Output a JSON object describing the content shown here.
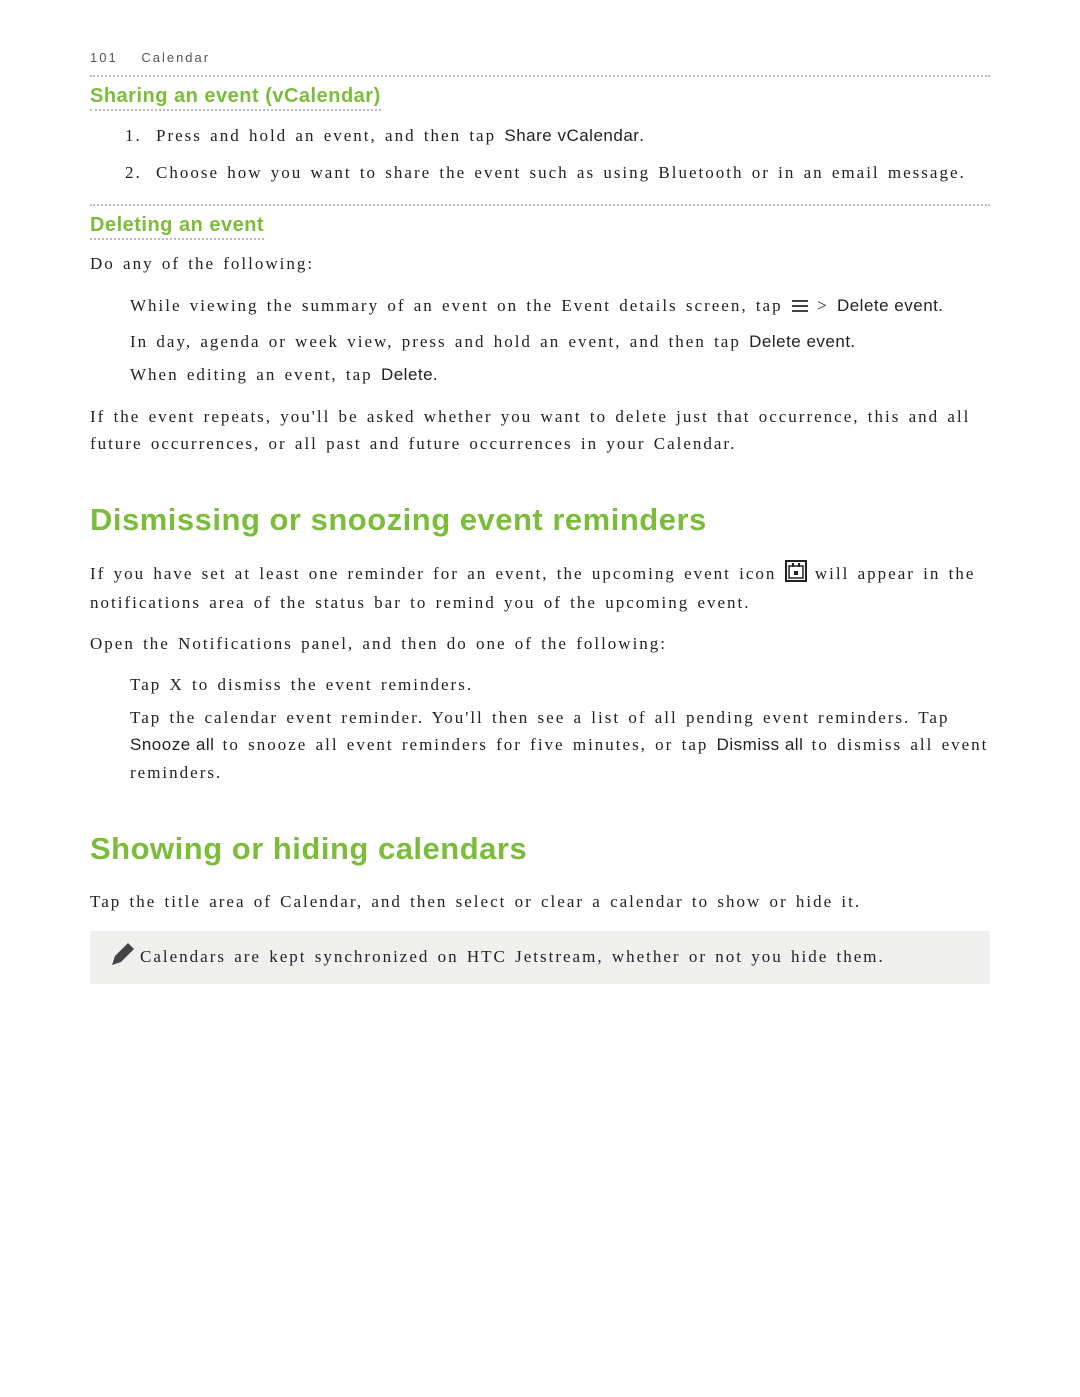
{
  "header": {
    "page_number": "101",
    "section": "Calendar"
  },
  "sharing": {
    "heading": "Sharing an event (vCalendar)",
    "steps": [
      {
        "pre": "Press and hold an event, and then tap ",
        "bold": "Share vCalendar",
        "post": "."
      },
      {
        "pre": "Choose how you want to share the event such as using Bluetooth or in an email message.",
        "bold": "",
        "post": ""
      }
    ]
  },
  "deleting": {
    "heading": "Deleting an event",
    "intro": "Do any of the following:",
    "items": [
      {
        "pre": "While viewing the summary of an event on the Event details screen, tap ",
        "icon": "menu",
        "mid": " > ",
        "bold": "Delete event",
        "post": "."
      },
      {
        "pre": "In day, agenda or week view, press and hold an event, and then tap ",
        "icon": "",
        "mid": "",
        "bold": "Delete event",
        "post": "."
      },
      {
        "pre": "When editing an event, tap ",
        "icon": "",
        "mid": "",
        "bold": "Delete",
        "post": "."
      }
    ],
    "footer": "If the event repeats, you'll be asked whether you want to delete just that occurrence, this and all future occurrences, or all past and future occurrences in your Calendar."
  },
  "dismissing": {
    "heading": "Dismissing or snoozing event reminders",
    "para1_pre": "If you have set at least one reminder for an event, the upcoming event icon ",
    "para1_post": " will appear in the notifications area of the status bar to remind you of the upcoming event.",
    "para2": "Open the Notifications panel, and then do one of the following:",
    "items": [
      {
        "text": "Tap X to dismiss the event reminders."
      },
      {
        "text_pre": "Tap the calendar event reminder. You'll then see a list of all pending event reminders. Tap ",
        "bold1": "Snooze all",
        "text_mid": " to snooze all event reminders for five minutes, or tap ",
        "bold2": "Dismiss all",
        "text_post": " to dismiss all event reminders."
      }
    ]
  },
  "showing": {
    "heading": "Showing or hiding calendars",
    "para": "Tap the title area of Calendar, and then select or clear a calendar to show or hide it.",
    "note": "Calendars are kept synchronized on HTC Jetstream, whether or not you hide them."
  }
}
